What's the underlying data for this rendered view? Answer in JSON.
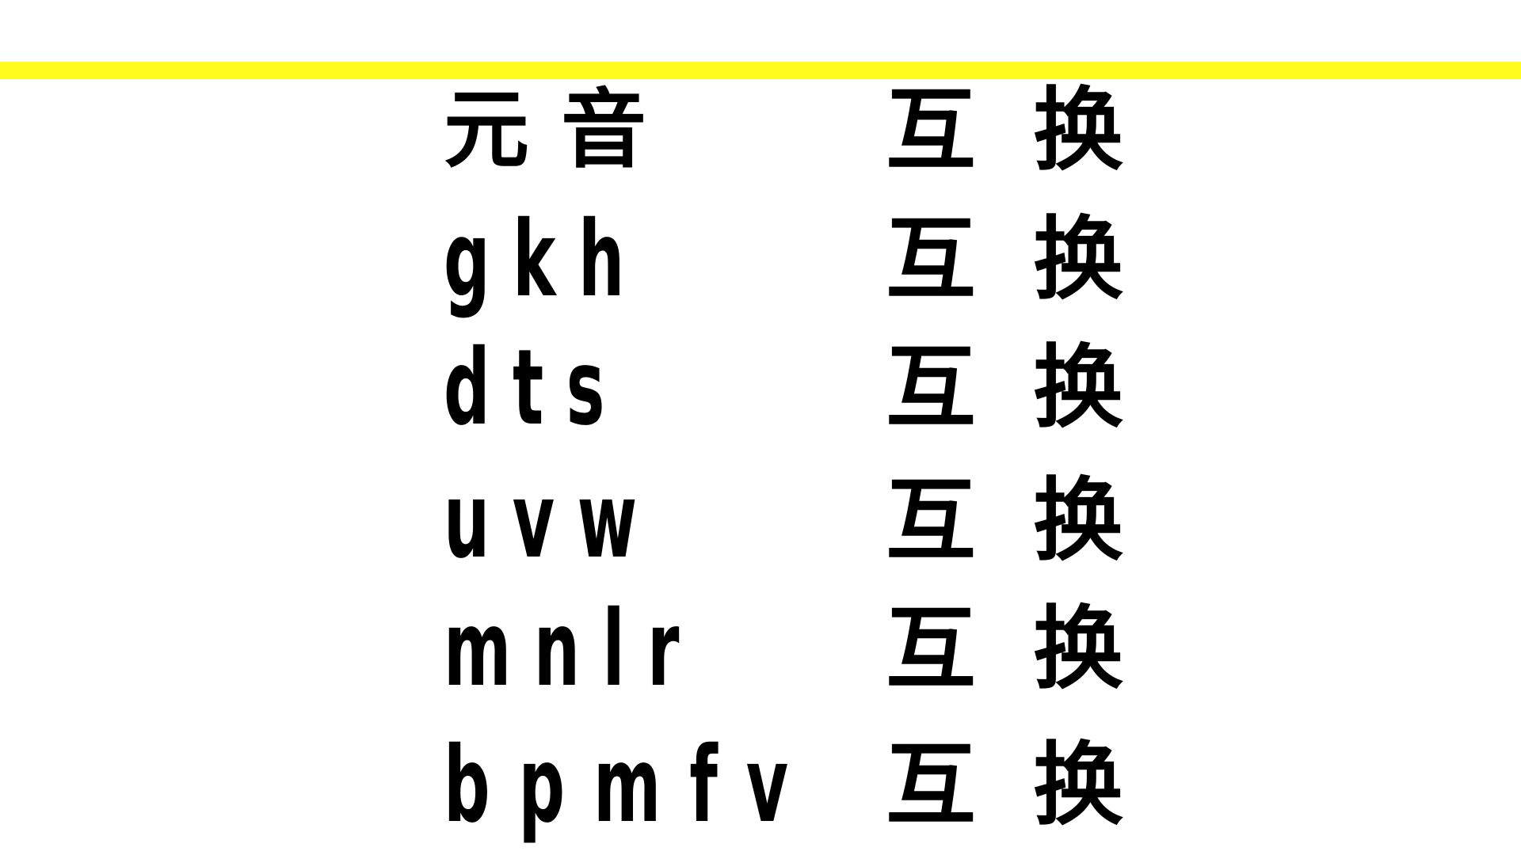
{
  "colors": {
    "background": "#ffffff",
    "accent_rule": "#fffb1a",
    "text": "#000000"
  },
  "rows": [
    {
      "left": "元音",
      "right": "互换"
    },
    {
      "left": "g k h",
      "right": "互换"
    },
    {
      "left": "d t s",
      "right": "互换"
    },
    {
      "left": "u v w",
      "right": "互换"
    },
    {
      "left": "m n l r",
      "right": "互换"
    },
    {
      "left": "b p m f v",
      "right": "互换"
    }
  ]
}
